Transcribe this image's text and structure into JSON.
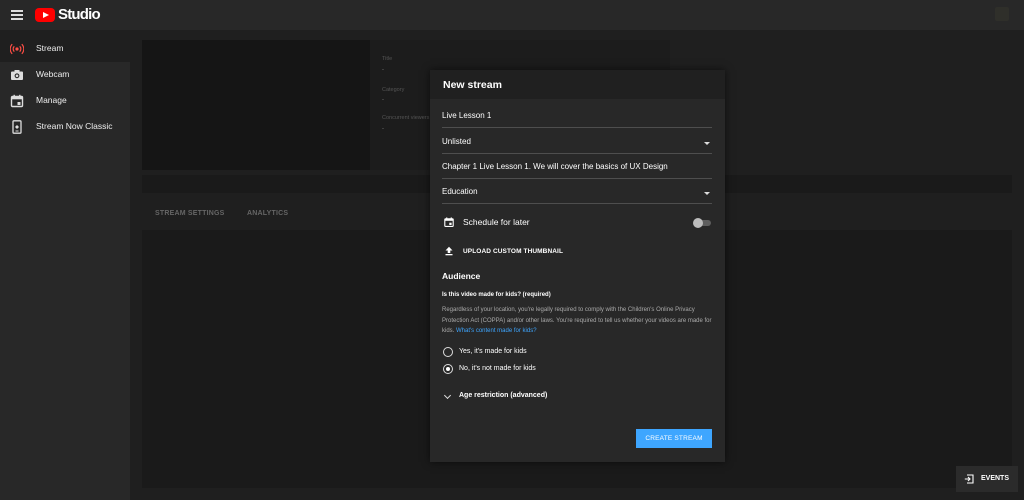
{
  "app": {
    "name": "Studio"
  },
  "sidebar": {
    "items": [
      {
        "label": "Stream",
        "icon": "stream-icon"
      },
      {
        "label": "Webcam",
        "icon": "camera-icon"
      },
      {
        "label": "Manage",
        "icon": "calendar-icon"
      },
      {
        "label": "Stream Now Classic",
        "icon": "phone-icon"
      }
    ]
  },
  "background": {
    "info": [
      {
        "label": "Title",
        "value": "-"
      },
      {
        "label": "Category",
        "value": "-"
      },
      {
        "label": "Concurrent viewers",
        "value": "-"
      }
    ],
    "tabs": [
      "STREAM SETTINGS",
      "ANALYTICS"
    ]
  },
  "modal": {
    "title": "New stream",
    "title_value": "Live Lesson 1",
    "visibility_value": "Unlisted",
    "description_value": "Chapter 1 Live Lesson 1. We will cover the basics of UX Design",
    "category_value": "Education",
    "schedule_label": "Schedule for later",
    "schedule_enabled": false,
    "upload_label": "UPLOAD CUSTOM THUMBNAIL",
    "audience_heading": "Audience",
    "kids_question": "Is this video made for kids? (required)",
    "kids_description": "Regardless of your location, you're legally required to comply with the Children's Online Privacy Protection Act (COPPA) and/or other laws. You're required to tell us whether your videos are made for kids.",
    "kids_link": "What's content made for kids?",
    "radio_yes": "Yes, it's made for kids",
    "radio_no": "No, it's not made for kids",
    "selected_audience": "no",
    "age_restriction": "Age restriction (advanced)",
    "create_button": "CREATE STREAM"
  },
  "events_button": "EVENTS",
  "colors": {
    "accent": "#3ea6ff",
    "brand": "#ff0000",
    "background": "#1f1f1f",
    "surface": "#282828"
  }
}
